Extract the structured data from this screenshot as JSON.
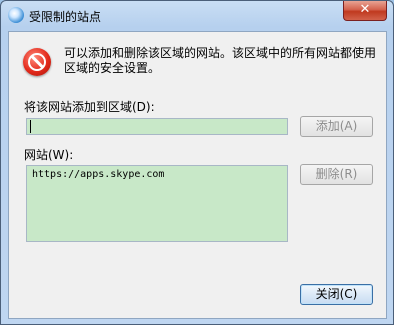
{
  "window": {
    "title": "受限制的站点",
    "close_glyph": "✕"
  },
  "message": "可以添加和删除该区域的网站。该区域中的所有网站都使用区域的安全设置。",
  "add_section": {
    "label": "将该网站添加到区域(D):",
    "input_value": "",
    "add_button": "添加(A)"
  },
  "sites_section": {
    "label": "网站(W):",
    "items": [
      "https://apps.skype.com"
    ],
    "remove_button": "删除(R)"
  },
  "footer": {
    "close_button": "关闭(C)"
  },
  "icons": {
    "title_icon": "globe-icon",
    "message_icon": "prohibited-icon",
    "close_icon": "close-icon"
  },
  "colors": {
    "field_background": "#c8e8c8",
    "dialog_background": "#f0f0f0",
    "close_button": "#c0391f"
  }
}
